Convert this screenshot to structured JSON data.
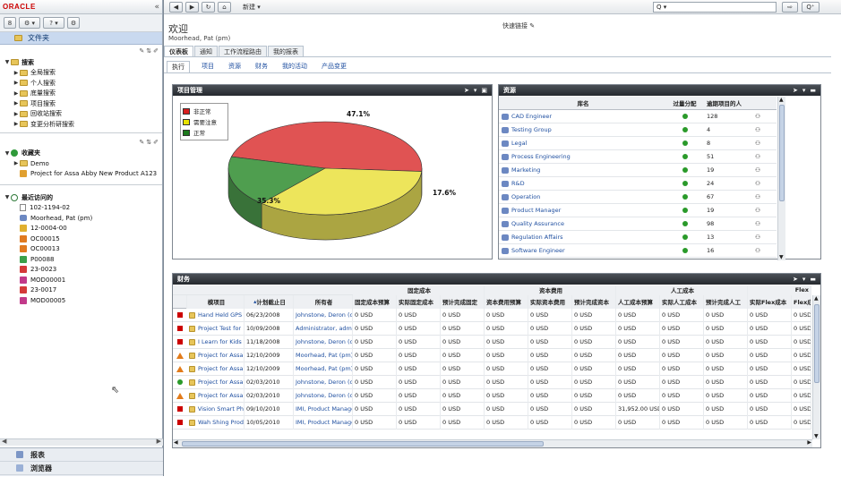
{
  "left": {
    "logo": "ORACLE",
    "collapse_glyph": "«",
    "tools": [
      "8",
      "⚙ ▾",
      "? ▾",
      "⚙"
    ],
    "folder_title": "文件夹",
    "searches": {
      "label": "搜索",
      "items": [
        "全局搜索",
        "个人搜索",
        "底量搜索",
        "项目搜索",
        "回收站搜索",
        "变更分析研搜索"
      ]
    },
    "favorites": {
      "label": "收藏夹",
      "items": [
        "Demo",
        "Project for Assa Abby New Product A123"
      ]
    },
    "recent": {
      "label": "最近访问的",
      "items": [
        "102-1194-02",
        "Moorhead, Pat (pm)",
        "12-0004-00",
        "OC00015",
        "OC00013",
        "P00088",
        "23-0023",
        "MOD00001",
        "23-0017",
        "MOD00005"
      ]
    },
    "bottom": [
      "报表",
      "浏览器"
    ]
  },
  "topbar": {
    "nav": [
      "◀",
      "▶",
      "↻",
      "⌂"
    ],
    "new_label": "新建 ▾",
    "search_placeholder": "Q ▾",
    "search_go": "⇨",
    "search_adv": "Q⁺"
  },
  "header": {
    "welcome": "欢迎",
    "user": "Moorhead, Pat (pm)",
    "quick_links": "快速链接"
  },
  "tabs1": [
    "仪表板",
    "通知",
    "工作流程路由",
    "我的报表"
  ],
  "tabs2": [
    "执行",
    "项目",
    "资源",
    "财务",
    "我的活动",
    "产品变更"
  ],
  "project_panel": {
    "title": "项目管理",
    "legend": [
      {
        "label": "非正常",
        "color": "#d81e1e"
      },
      {
        "label": "需要注意",
        "color": "#e8e200"
      },
      {
        "label": "正常",
        "color": "#1d7a1d"
      }
    ],
    "chart_data": {
      "type": "pie",
      "categories": [
        "非正常",
        "需要注意",
        "正常"
      ],
      "values": [
        47.1,
        35.3,
        17.6
      ],
      "data_labels": [
        "47.1%",
        "35.3%",
        "17.6%"
      ],
      "colors": [
        "#e05353",
        "#ede55b",
        "#4f9e4f"
      ]
    }
  },
  "resource_panel": {
    "title": "资源",
    "headers": [
      "库名",
      "过量分配",
      "逾期项目的人"
    ],
    "rows": [
      {
        "name": "CAD Engineer",
        "days": "128"
      },
      {
        "name": "Testing Group",
        "days": "4"
      },
      {
        "name": "Legal",
        "days": "8"
      },
      {
        "name": "Process Engineering",
        "days": "51"
      },
      {
        "name": "Marketing",
        "days": "19"
      },
      {
        "name": "R&D",
        "days": "24"
      },
      {
        "name": "Operation",
        "days": "67"
      },
      {
        "name": "Product Manager",
        "days": "19"
      },
      {
        "name": "Quality Assurance",
        "days": "98"
      },
      {
        "name": "Regulation Affairs",
        "days": "13"
      },
      {
        "name": "Software Engineer",
        "days": "16"
      }
    ]
  },
  "finance_panel": {
    "title": "财务",
    "group_headers": [
      "固定成本",
      "资本费用",
      "人工成本",
      "Flex"
    ],
    "headers": [
      "模项目",
      "计划截止日",
      "所有者",
      "固定成本预算",
      "实际固定成本",
      "预计完成固定",
      "资本费用预算",
      "实际资本费用",
      "预计完成资本",
      "人工成本预算",
      "实际人工成本",
      "预计完成人工",
      "实际Flex成本",
      "Flex成"
    ],
    "rows": [
      {
        "status": "red",
        "name": "Hand Held GPS",
        "date": "06/23/2008",
        "owner": "Johnstone, Deron (c",
        "v": [
          "0 USD",
          "0 USD",
          "0 USD",
          "0 USD",
          "0 USD",
          "0 USD",
          "0 USD",
          "0 USD",
          "0 USD",
          "0 USD",
          "0 USD"
        ]
      },
      {
        "status": "red",
        "name": "Project Test for",
        "date": "10/09/2008",
        "owner": "Administrator, admir",
        "v": [
          "0 USD",
          "0 USD",
          "0 USD",
          "0 USD",
          "0 USD",
          "0 USD",
          "0 USD",
          "0 USD",
          "0 USD",
          "0 USD",
          "0 USD"
        ]
      },
      {
        "status": "red",
        "name": "I Learn for Kids",
        "date": "11/18/2008",
        "owner": "Johnstone, Deron (c",
        "v": [
          "0 USD",
          "0 USD",
          "0 USD",
          "0 USD",
          "0 USD",
          "0 USD",
          "0 USD",
          "0 USD",
          "0 USD",
          "0 USD",
          "0 USD"
        ]
      },
      {
        "status": "orange",
        "name": "Project for Assa",
        "date": "12/10/2009",
        "owner": "Moorhead, Pat (pm)",
        "v": [
          "0 USD",
          "0 USD",
          "0 USD",
          "0 USD",
          "0 USD",
          "0 USD",
          "0 USD",
          "0 USD",
          "0 USD",
          "0 USD",
          "0 USD"
        ]
      },
      {
        "status": "orange",
        "name": "Project for Assa",
        "date": "12/10/2009",
        "owner": "Moorhead, Pat (pm)",
        "v": [
          "0 USD",
          "0 USD",
          "0 USD",
          "0 USD",
          "0 USD",
          "0 USD",
          "0 USD",
          "0 USD",
          "0 USD",
          "0 USD",
          "0 USD"
        ]
      },
      {
        "status": "green",
        "name": "Project for Assa",
        "date": "02/03/2010",
        "owner": "Johnstone, Deron (c",
        "v": [
          "0 USD",
          "0 USD",
          "0 USD",
          "0 USD",
          "0 USD",
          "0 USD",
          "0 USD",
          "0 USD",
          "0 USD",
          "0 USD",
          "0 USD"
        ]
      },
      {
        "status": "orange",
        "name": "Project for Assa",
        "date": "02/03/2010",
        "owner": "Johnstone, Deron (c",
        "v": [
          "0 USD",
          "0 USD",
          "0 USD",
          "0 USD",
          "0 USD",
          "0 USD",
          "0 USD",
          "0 USD",
          "0 USD",
          "0 USD",
          "0 USD"
        ]
      },
      {
        "status": "red",
        "name": "Vision Smart Ph",
        "date": "09/10/2010",
        "owner": "IMI, Product Manage",
        "v": [
          "0 USD",
          "0 USD",
          "0 USD",
          "0 USD",
          "0 USD",
          "0 USD",
          "31,952.00 USD",
          "0 USD",
          "0 USD",
          "0 USD",
          "0 USD"
        ]
      },
      {
        "status": "red",
        "name": "Wah Shing Prod",
        "date": "10/05/2010",
        "owner": "IMI, Product Manage",
        "v": [
          "0 USD",
          "0 USD",
          "0 USD",
          "0 USD",
          "0 USD",
          "0 USD",
          "0 USD",
          "0 USD",
          "0 USD",
          "0 USD",
          "0 USD"
        ]
      }
    ]
  }
}
